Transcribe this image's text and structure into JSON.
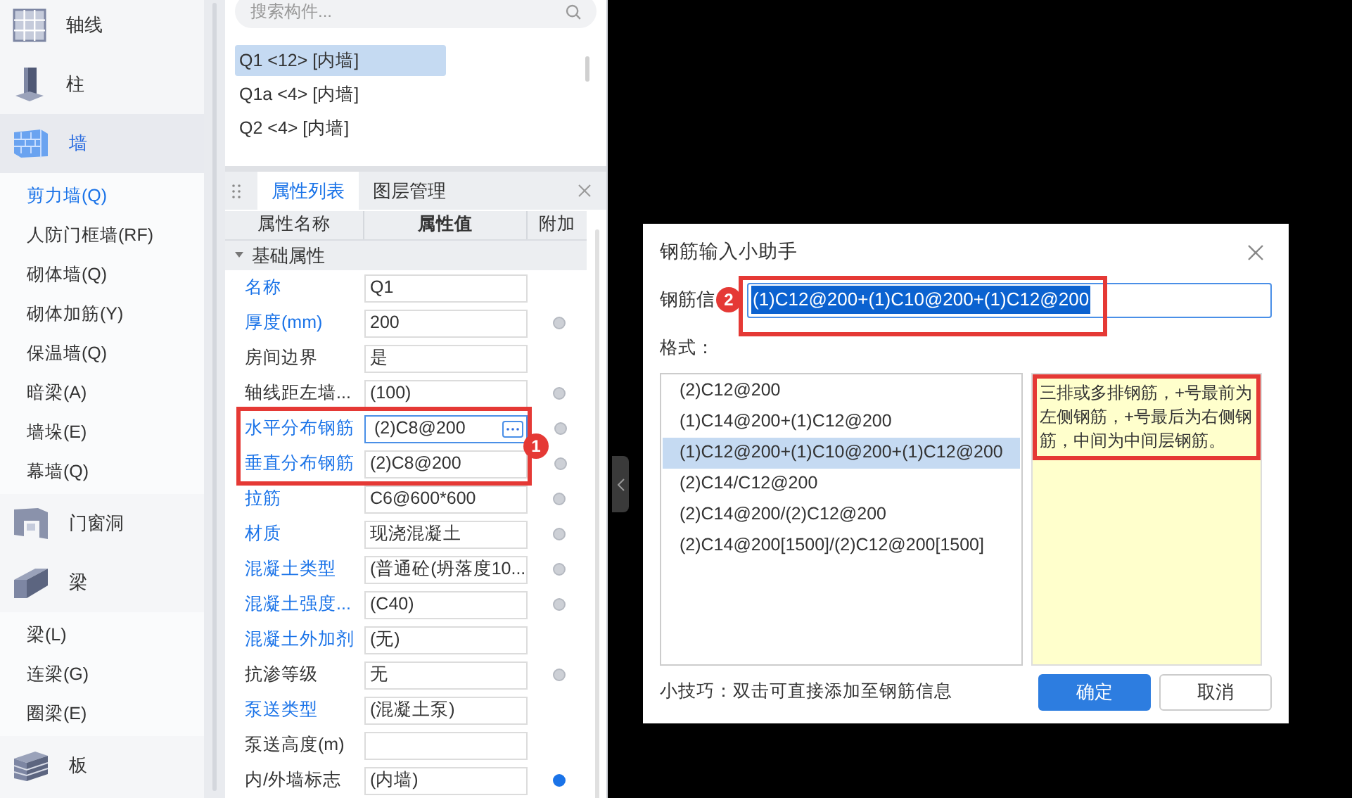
{
  "sidebar": {
    "categories": [
      {
        "label": "轴线",
        "kind": "grid",
        "selected": false
      },
      {
        "label": "柱",
        "kind": "column",
        "selected": false
      },
      {
        "label": "墙",
        "kind": "wall",
        "selected": true,
        "children": [
          {
            "label": "剪力墙(Q)",
            "selected": true
          },
          {
            "label": "人防门框墙(RF)",
            "selected": false
          },
          {
            "label": "砌体墙(Q)",
            "selected": false
          },
          {
            "label": "砌体加筋(Y)",
            "selected": false
          },
          {
            "label": "保温墙(Q)",
            "selected": false
          },
          {
            "label": "暗梁(A)",
            "selected": false
          },
          {
            "label": "墙垛(E)",
            "selected": false
          },
          {
            "label": "幕墙(Q)",
            "selected": false
          }
        ]
      },
      {
        "label": "门窗洞",
        "kind": "opening",
        "selected": false
      },
      {
        "label": "梁",
        "kind": "beam",
        "selected": false,
        "children": [
          {
            "label": "梁(L)",
            "selected": false
          },
          {
            "label": "连梁(G)",
            "selected": false
          },
          {
            "label": "圈梁(E)",
            "selected": false
          }
        ]
      },
      {
        "label": "板",
        "kind": "slab",
        "selected": false
      }
    ]
  },
  "search": {
    "placeholder": "搜索构件..."
  },
  "components": [
    {
      "label": "Q1 <12> [内墙]",
      "selected": true
    },
    {
      "label": "Q1a <4> [内墙]",
      "selected": false
    },
    {
      "label": "Q2 <4> [内墙]",
      "selected": false
    }
  ],
  "tabs": [
    {
      "label": "属性列表",
      "selected": true
    },
    {
      "label": "图层管理",
      "selected": false
    }
  ],
  "table": {
    "columns": [
      "属性名称",
      "属性值",
      "附加"
    ],
    "group": "基础属性",
    "rows": [
      {
        "name": "名称",
        "value": "Q1",
        "linked": true,
        "editing": false,
        "highlighted": false
      },
      {
        "name": "厚度(mm)",
        "value": "200",
        "linked": true,
        "editing": false,
        "highlighted": false,
        "dot_filled": false
      },
      {
        "name": "房间边界",
        "value": "是",
        "linked": false,
        "editing": false,
        "highlighted": false
      },
      {
        "name": "轴线距左墙...",
        "value": "(100)",
        "linked": false,
        "editing": false,
        "highlighted": false,
        "dot_filled": false
      },
      {
        "name": "水平分布钢筋",
        "value": "(2)C8@200",
        "linked": true,
        "editing": true,
        "highlighted": true,
        "dot_filled": false
      },
      {
        "name": "垂直分布钢筋",
        "value": "(2)C8@200",
        "linked": true,
        "editing": false,
        "highlighted": true,
        "dot_filled": false
      },
      {
        "name": "拉筋",
        "value": "C6@600*600",
        "linked": true,
        "editing": false,
        "highlighted": false,
        "dot_filled": false
      },
      {
        "name": "材质",
        "value": "现浇混凝土",
        "linked": true,
        "editing": false,
        "highlighted": false,
        "dot_filled": false
      },
      {
        "name": "混凝土类型",
        "value": "(普通砼(坍落度10...",
        "linked": true,
        "editing": false,
        "highlighted": false,
        "dot_filled": false
      },
      {
        "name": "混凝土强度...",
        "value": "(C40)",
        "linked": true,
        "editing": false,
        "highlighted": false,
        "dot_filled": false
      },
      {
        "name": "混凝土外加剂",
        "value": "(无)",
        "linked": true,
        "editing": false,
        "highlighted": false
      },
      {
        "name": "抗渗等级",
        "value": "无",
        "linked": false,
        "editing": false,
        "highlighted": false,
        "dot_filled": false
      },
      {
        "name": "泵送类型",
        "value": "(混凝土泵)",
        "linked": true,
        "editing": false,
        "highlighted": false
      },
      {
        "name": "泵送高度(m)",
        "value": "",
        "linked": false,
        "editing": false,
        "highlighted": false
      },
      {
        "name": "内/外墙标志",
        "value": "(内墙)",
        "linked": false,
        "editing": false,
        "highlighted": false,
        "dot_filled": true
      }
    ]
  },
  "marker_1": "1",
  "dialog": {
    "title": "钢筋输入小助手",
    "field_label": "钢筋信",
    "value": "(1)C12@200+(1)C10@200+(1)C12@200",
    "marker": "2",
    "format_label": "格式：",
    "formats": [
      {
        "label": "(2)C12@200",
        "selected": false
      },
      {
        "label": "(1)C14@200+(1)C12@200",
        "selected": false
      },
      {
        "label": "(1)C12@200+(1)C10@200+(1)C12@200",
        "selected": true
      },
      {
        "label": "(2)C14/C12@200",
        "selected": false
      },
      {
        "label": "(2)C14@200/(2)C12@200",
        "selected": false
      },
      {
        "label": "(2)C14@200[1500]/(2)C12@200[1500]",
        "selected": false
      }
    ],
    "hint": "三排或多排钢筋，+号最前为左侧钢筋，+号最后为右侧钢筋，中间为中间层钢筋。",
    "tip": "小技巧：双击可直接添加至钢筋信息",
    "buttons": [
      {
        "label": "确定",
        "kind": "primary"
      },
      {
        "label": "取消",
        "kind": "secondary"
      }
    ]
  }
}
